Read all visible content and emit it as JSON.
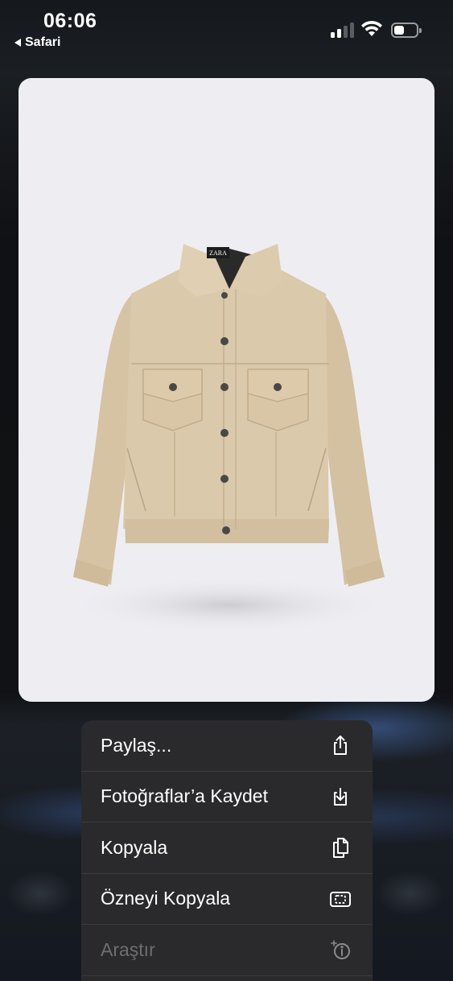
{
  "status_bar": {
    "time": "06:06",
    "back_app_label": "Safari",
    "icons": [
      "cellular-signal-icon",
      "wifi-icon",
      "battery-icon"
    ]
  },
  "image": {
    "subject": "beige jacket",
    "brand_label": "ZARA"
  },
  "context_menu": {
    "items": [
      {
        "label": "Paylaş...",
        "icon": "share-icon",
        "enabled": true
      },
      {
        "label": "Fotoğraflar’a Kaydet",
        "icon": "save-download-icon",
        "enabled": true
      },
      {
        "label": "Kopyala",
        "icon": "copy-icon",
        "enabled": true
      },
      {
        "label": "Özneyi Kopyala",
        "icon": "copy-subject-icon",
        "enabled": true
      },
      {
        "label": "Araştır",
        "icon": "look-up-icon",
        "enabled": false
      }
    ]
  },
  "colors": {
    "menu_bg": "#2a2a2c",
    "card_bg": "#eeedf2",
    "jacket": "#d9c7a8",
    "disabled_text": "#6e6e72"
  }
}
